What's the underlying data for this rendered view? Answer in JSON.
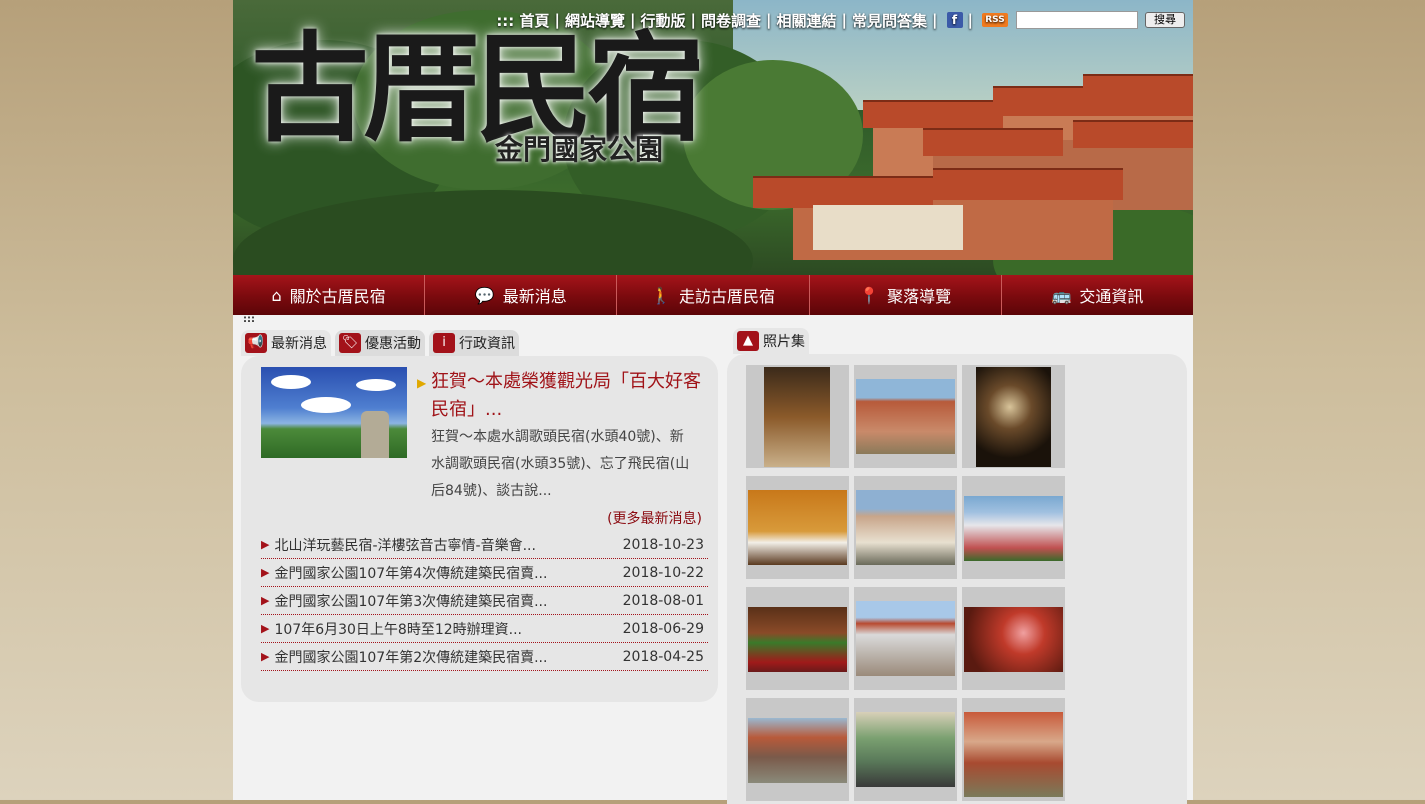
{
  "top_links": [
    "::: 首頁",
    "網站導覽",
    "行動版",
    "問卷調查",
    "相關連結",
    "常見問答集"
  ],
  "social": {
    "fb": "f",
    "rss": "RSS"
  },
  "search": {
    "placeholder": "",
    "button": "搜尋"
  },
  "banner": {
    "title": "古厝民宿",
    "subtitle": "金門國家公園"
  },
  "nav": [
    {
      "label": "關於古厝民宿",
      "icon": "home-icon"
    },
    {
      "label": "最新消息",
      "icon": "chat-bubble-icon"
    },
    {
      "label": "走訪古厝民宿",
      "icon": "walking-person-icon"
    },
    {
      "label": "聚落導覽",
      "icon": "map-pin-icon"
    },
    {
      "label": "交通資訊",
      "icon": "bus-icon"
    }
  ],
  "left_tabs": [
    {
      "label": "最新消息",
      "icon": "megaphone-icon"
    },
    {
      "label": "優惠活動",
      "icon": "tag-icon"
    },
    {
      "label": "行政資訊",
      "icon": "info-icon"
    }
  ],
  "featured": {
    "title": "狂賀～本處榮獲觀光局「百大好客民宿」...",
    "desc": "狂賀～本處水調歌頭民宿(水頭40號)、新水調歌頭民宿(水頭35號)、忘了飛民宿(山后84號)、談古說...",
    "more": "(更多最新消息)"
  },
  "news": [
    {
      "title": "北山洋玩藝民宿-洋樓弦音古寧情-音樂會...",
      "date": "2018-10-23"
    },
    {
      "title": "金門國家公園107年第4次傳統建築民宿賣...",
      "date": "2018-10-22"
    },
    {
      "title": "金門國家公園107年第3次傳統建築民宿賣...",
      "date": "2018-08-01"
    },
    {
      "title": "107年6月30日上午8時至12時辦理資...",
      "date": "2018-06-29"
    },
    {
      "title": "金門國家公園107年第2次傳統建築民宿賣...",
      "date": "2018-04-25"
    }
  ],
  "photos_tab": {
    "label": "照片集",
    "icon": "photo-icon"
  },
  "dots": ":::"
}
